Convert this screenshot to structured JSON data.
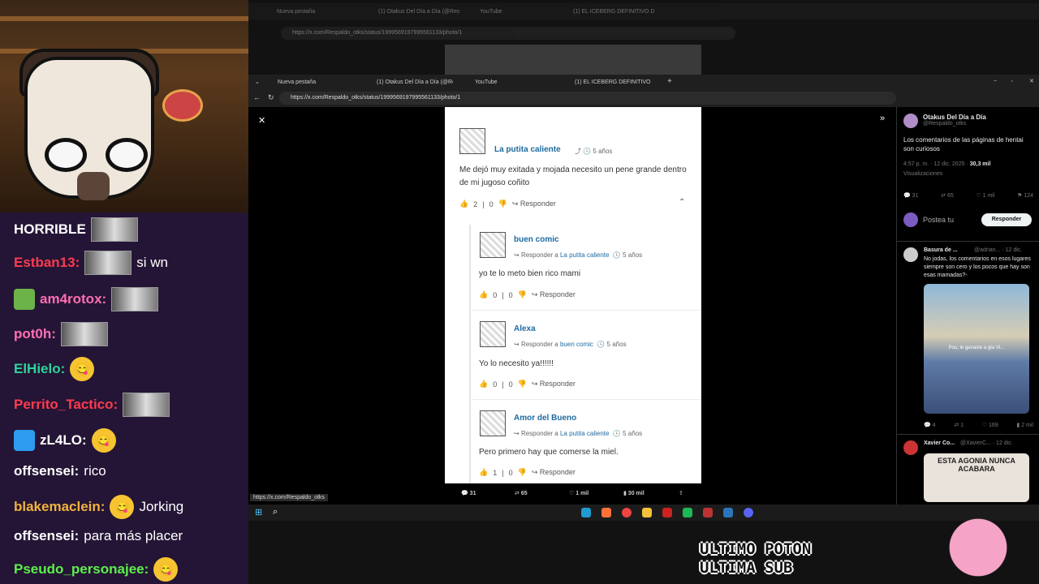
{
  "chat": [
    {
      "user": "HORRIBLE",
      "color": "#ffffff",
      "msg": "",
      "emote": "emote"
    },
    {
      "user": "Estban13:",
      "color": "#ff3b4e",
      "msg": "si wn",
      "emote": "emote"
    },
    {
      "user": "am4rotox:",
      "color": "#ff6fb2",
      "msg": "",
      "emote": "emote",
      "pfp": true
    },
    {
      "user": "pot0h:",
      "color": "#ff6fb2",
      "msg": "",
      "emote": "emote"
    },
    {
      "user": "ElHielo:",
      "color": "#2fd39a",
      "msg": "",
      "emote": "emoji"
    },
    {
      "user": "Perrito_Tactico:",
      "color": "#ff3b4e",
      "msg": "",
      "emote": "emote"
    },
    {
      "user": "zL4LO:",
      "color": "#ffffff",
      "msg": "",
      "emote": "emoji",
      "badge": true
    },
    {
      "user": "offsensei:",
      "color": "#ffffff",
      "msg": "rico"
    },
    {
      "user": "blakemaclein:",
      "color": "#f2b33d",
      "msg": "Jorking",
      "emote": "emoji"
    },
    {
      "user": "offsensei:",
      "color": "#ffffff",
      "msg": "para más placer"
    },
    {
      "user": "Pseudo_personajee:",
      "color": "#5df04a",
      "msg": "",
      "emote": "emoji"
    }
  ],
  "tabs": {
    "t1": "Nueva pestaña",
    "t2": "(1) Otakus Del Día a Día (@Respal...",
    "t3": "YouTube",
    "t4": "(1) EL ICEBERG DEFINITIVO DE GU..."
  },
  "url": "https://x.com/Respaldo_otks/status/1999569197995561133/photo/1",
  "bg_url": "https://x.com/Respaldo_otks/status/1999569197995561133/photo/1",
  "bg_tabs": {
    "t1": "Nueva pestaña",
    "t2": "(1) Otakus Del Día a Día (@Respal...",
    "t3": "YouTube",
    "t4": "(1) EL ICEBERG DEFINITIVO DE GU..."
  },
  "comments": {
    "c1": {
      "user": "La putita caliente",
      "age": "5 años",
      "text": "Me dejó muy exitada y mojada necesito un pene grande dentro de mi jugoso coñito",
      "up": "2",
      "down": "0",
      "reply": "Responder"
    },
    "c2": {
      "user": "buen comic",
      "to": "La putita caliente",
      "age": "5 años",
      "text": "yo te lo meto bien rico mami",
      "up": "0",
      "down": "0",
      "reply": "Responder"
    },
    "c3": {
      "user": "Alexa",
      "to": "buen comic",
      "age": "5 años",
      "text": "Yo lo necesito ya!!!!!!",
      "up": "0",
      "down": "0",
      "reply": "Responder"
    },
    "c4": {
      "user": "Amor del Bueno",
      "to": "La putita caliente",
      "age": "5 años",
      "text": "Pero primero hay que comerse la miel.",
      "up": "1",
      "down": "0",
      "reply": "Responder"
    },
    "reply_prefix": "Responder a"
  },
  "actions": {
    "replies": "31",
    "reposts": "65",
    "likes": "1 mil",
    "views": "30 mil"
  },
  "rpanel": {
    "name": "Otakus Del Día a Día",
    "handle": "@Respaldo_otks",
    "text": "Los comentarios de las páginas de hentai son curiosos",
    "time": "4:57 p. m. · 12 dic. 2025 ·",
    "views": "30,3 mil",
    "views_label": "Visualizaciones",
    "stats": [
      "31",
      "65",
      "1 mil",
      "124"
    ],
    "compose": "Postea tu",
    "reply_btn": "Responder",
    "r1_name": "Basura de ...",
    "r1_handle": "@adrian... · 12 dic.",
    "r1_text": "No jodas, los comentarios en esos lugares siempre son cero y los pocos que hay son esas mamadas?-",
    "r1_caption": "Pou, le ganaste a gta VI...",
    "r1_stats": [
      "4",
      "1",
      "169",
      "2 mil"
    ],
    "r2_name": "Xavier Co...",
    "r2_handle": "@XavierC... · 12 dic.",
    "r2_caption": "ESTA AGONIA NUNCA ACABARA"
  },
  "status_url": "https://x.com/Respaldo_otks",
  "overlay": {
    "line1": "ULTIMO POTON",
    "line2": "ULTIMA SUB"
  }
}
